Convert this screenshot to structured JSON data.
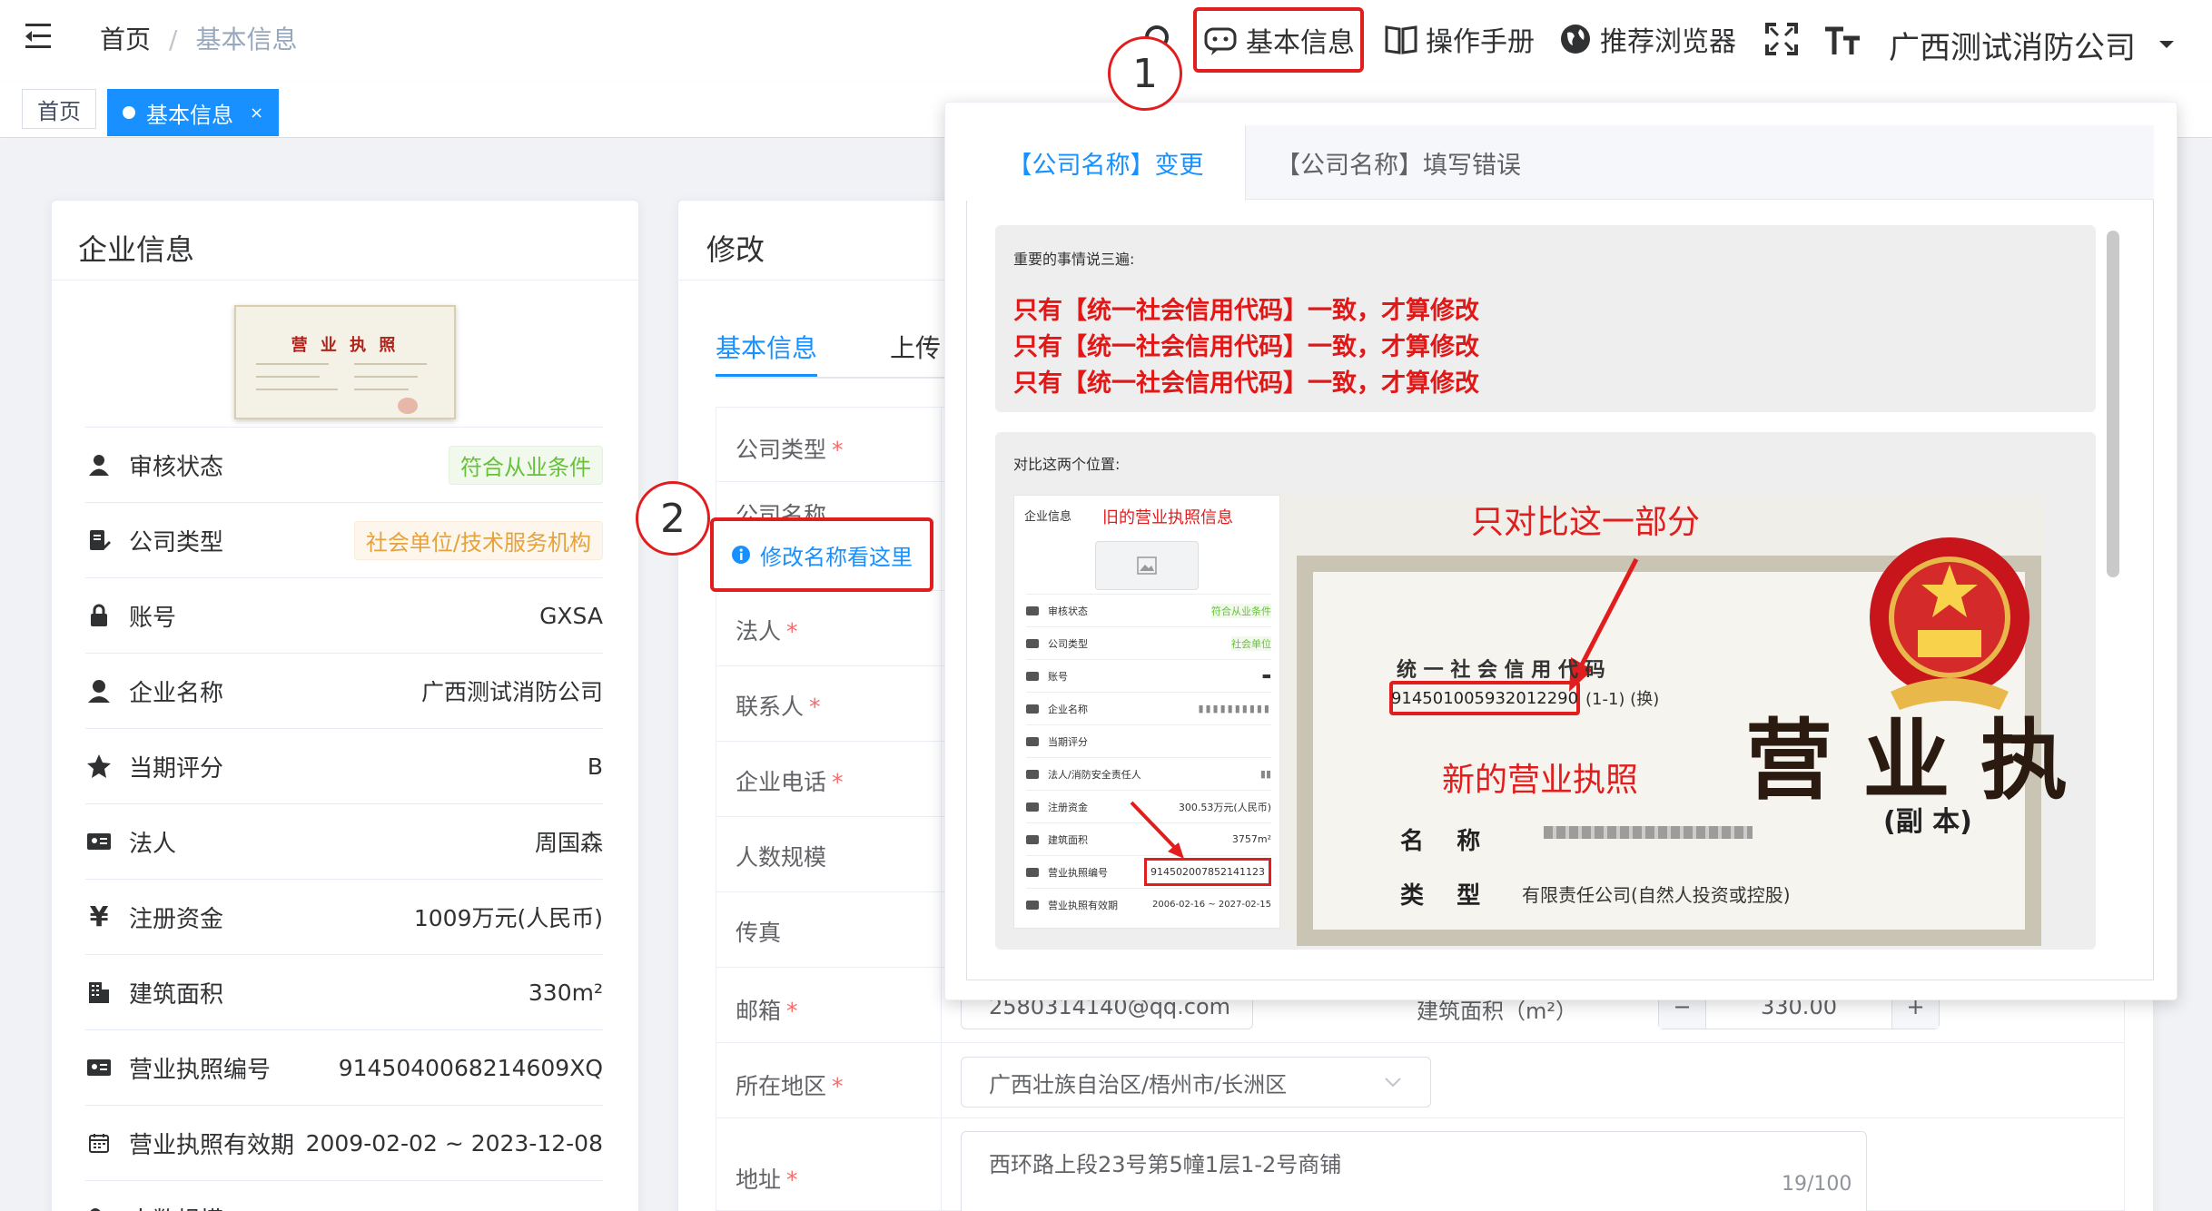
{
  "navbar": {
    "breadcrumb_home": "首页",
    "breadcrumb_sep": "/",
    "breadcrumb_current": "基本信息",
    "basic_info": "基本信息",
    "manual": "操作手册",
    "browser": "推荐浏览器",
    "company": "广西测试消防公司"
  },
  "annotations": {
    "one": "1",
    "two": "2"
  },
  "tags": {
    "home": "首页",
    "current": "基本信息",
    "close": "×"
  },
  "left_card": {
    "title": "企业信息",
    "license_title": "营 业 执 照",
    "rows": [
      {
        "label": "审核状态",
        "value": "符合从业条件"
      },
      {
        "label": "公司类型",
        "value": "社会单位/技术服务机构"
      },
      {
        "label": "账号",
        "value": "GXSA"
      },
      {
        "label": "企业名称",
        "value": "广西测试消防公司"
      },
      {
        "label": "当期评分",
        "value": "B"
      },
      {
        "label": "法人",
        "value": "周国森"
      },
      {
        "label": "注册资金",
        "value": "1009万元(人民币)"
      },
      {
        "label": "建筑面积",
        "value": "330m²"
      },
      {
        "label": "营业执照编号",
        "value": "9145040068214609XQ"
      },
      {
        "label": "营业执照有效期",
        "value": "2009-02-02 ~ 2023-12-08"
      },
      {
        "label": "人数规模",
        "value": "-"
      }
    ]
  },
  "right_card": {
    "title": "修改",
    "tab_basic": "基本信息",
    "tab_upload": "上传",
    "fields": [
      {
        "label": "公司类型",
        "required": "*"
      },
      {
        "label": "公司名称",
        "required": ""
      },
      {
        "label": "法人",
        "required": "*"
      },
      {
        "label": "联系人",
        "required": "*"
      },
      {
        "label": "企业电话",
        "required": "*"
      },
      {
        "label": "人数规模",
        "required": ""
      },
      {
        "label": "传真",
        "required": ""
      },
      {
        "label": "邮箱",
        "required": "*"
      },
      {
        "label": "所在地区",
        "required": "*"
      },
      {
        "label": "地址",
        "required": "*"
      }
    ],
    "rename_hint": "修改名称看这里",
    "email_value": "2580314140@qq.com",
    "area_label": "建筑面积（m²）",
    "area_minus": "−",
    "area_value": "330.00",
    "area_plus": "+",
    "region_value": "广西壮族自治区/梧州市/长洲区",
    "address_value": "西环路上段23号第5幢1层1-2号商铺",
    "address_count": "19/100"
  },
  "popover": {
    "tab_active": "【公司名称】变更",
    "tab_inactive": "【公司名称】填写错误",
    "notice_title": "重要的事情说三遍:",
    "notice_lines": [
      "只有【统一社会信用代码】一致，才算修改",
      "只有【统一社会信用代码】一致，才算修改",
      "只有【统一社会信用代码】一致，才算修改"
    ],
    "compare_title": "对比这两个位置:",
    "old_label": "旧的营业执照信息",
    "new_label": "新的营业执照",
    "compare_only": "只对比这一部分",
    "mini_title": "企业信息",
    "mini_rows": [
      {
        "label": "审核状态",
        "value": "符合从业条件"
      },
      {
        "label": "公司类型",
        "value": "社会单位"
      },
      {
        "label": "账号",
        "value": "▬"
      },
      {
        "label": "企业名称",
        "value": "▮▮▮▮▮▮▮▮▮▮"
      },
      {
        "label": "当期评分",
        "value": ""
      },
      {
        "label": "法人/消防安全责任人",
        "value": "▮▮"
      },
      {
        "label": "注册资金",
        "value": "300.53万元(人民币)"
      },
      {
        "label": "建筑面积",
        "value": "3757m²"
      },
      {
        "label": "营业执照编号",
        "value": "914502007852141123"
      },
      {
        "label": "营业执照有效期",
        "value": "2006-02-16 ~ 2027-02-15"
      }
    ],
    "cert_credit_title": "统 一 社 会 信 用 代 码",
    "cert_code": "914501005932012290",
    "cert_code_suffix": "(1-1) (换)",
    "cert_big": "营 业 执",
    "cert_copy": "(副 本)",
    "cert_name_label": "名    称",
    "cert_type_label": "类    型",
    "cert_type_value": "有限责任公司(自然人投资或控股)"
  },
  "colors": {
    "primary": "#1890ff",
    "red": "#e21d1d"
  }
}
